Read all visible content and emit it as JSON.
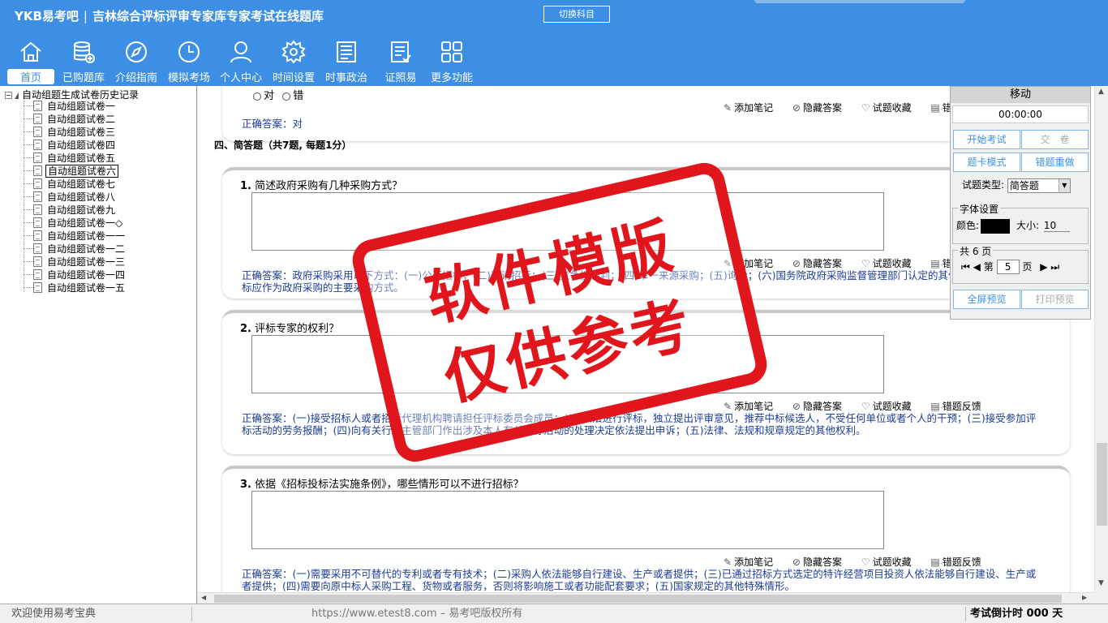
{
  "app": {
    "logo": "YKB易考吧",
    "title": "吉林综合评标评审专家库专家考试在线题库",
    "switch_subject": "切换科目"
  },
  "nav": [
    {
      "label": "首页",
      "icon": "home-icon"
    },
    {
      "label": "已购题库",
      "icon": "database-icon"
    },
    {
      "label": "介绍指南",
      "icon": "compass-icon"
    },
    {
      "label": "模拟考场",
      "icon": "clock-icon"
    },
    {
      "label": "个人中心",
      "icon": "user-icon"
    },
    {
      "label": "时间设置",
      "icon": "gear-icon"
    },
    {
      "label": "时事政治",
      "icon": "newspaper-icon"
    },
    {
      "label": "证照易",
      "icon": "checklist-icon"
    },
    {
      "label": "更多功能",
      "icon": "grid-icon"
    }
  ],
  "tree": {
    "root": "自动组题生成试卷历史记录",
    "items": [
      "自动组题试卷一",
      "自动组题试卷二",
      "自动组题试卷三",
      "自动组题试卷四",
      "自动组题试卷五",
      "自动组题试卷六",
      "自动组题试卷七",
      "自动组题试卷八",
      "自动组题试卷九",
      "自动组题试卷一◇",
      "自动组题试卷一一",
      "自动组题试卷一二",
      "自动组题试卷一三",
      "自动组题试卷一四",
      "自动组题试卷一五"
    ],
    "selected_index": 5
  },
  "main": {
    "prev": {
      "true_label": "对",
      "false_label": "错",
      "correct": "正确答案：对"
    },
    "section_title": "四、简答题（共7题, 每题1分）",
    "actions": {
      "note": "添加笔记",
      "hide": "隐藏答案",
      "fav": "试题收藏",
      "feedback": "错题反馈",
      "feedback_short": "错"
    },
    "questions": [
      {
        "num": "1.",
        "text": "简述政府采购有几种采购方式？",
        "correct": "正确答案：政府采购采用以下方式：(一)公开招标；(二)邀请招标；(三)竞争性谈判；(四)单一来源采购；(五)询价；(六)国务院政府采购监督管理部门认定的其他采购方式。公开招标应作为政府采购的主要采购方式。"
      },
      {
        "num": "2.",
        "text": "评标专家的权利？",
        "correct": "正确答案：(一)接受招标人或者招标代理机构聘请担任评标委员会成员；(二)依法进行评标，独立提出评审意见，推荐中标候选人，不受任何单位或者个人的干预；(三)接受参加评标活动的劳务报酬；(四)向有关行政主管部门作出涉及本人有关评标活动的处理决定依法提出申诉；(五)法律、法规和规章规定的其他权利。"
      },
      {
        "num": "3.",
        "text": "依据《招标投标法实施条例》，哪些情形可以不进行招标？",
        "correct": "正确答案：(一)需要采用不可替代的专利或者专有技术；(二)采购人依法能够自行建设、生产或者提供；(三)已通过招标方式选定的特许经营项目投资人依法能够自行建设、生产或者提供；(四)需要向原中标人采购工程、货物或者服务，否则将影响施工或者功能配套要求；(五)国家规定的其他特殊情形。"
      }
    ]
  },
  "panel": {
    "title": "移动",
    "timer": "00:00:00",
    "start_exam": "开始考试",
    "submit": "交　卷",
    "card_mode": "题卡模式",
    "redo_wrong": "错题重做",
    "type_label": "试题类型:",
    "type_value": "简答题",
    "font_legend": "字体设置",
    "color_label": "颜色:",
    "color_value": "#000000",
    "size_label": "大小:",
    "size_value": "10",
    "pages_legend": "共 6 页",
    "page_prefix": "第",
    "page_value": "5",
    "page_suffix": "页",
    "fullscreen": "全屏预览",
    "print": "打印预览"
  },
  "watermark": {
    "line1": "软件模版",
    "line2": "仅供参考"
  },
  "status": {
    "welcome": "欢迎使用易考宝典",
    "copyright": "https://www.etest8.com – 易考吧版权所有",
    "countdown": "考试倒计时 000 天"
  },
  "colors": {
    "header": "#3d8fe6",
    "answer_text": "#1c3e9a",
    "watermark": "#e0161c"
  }
}
